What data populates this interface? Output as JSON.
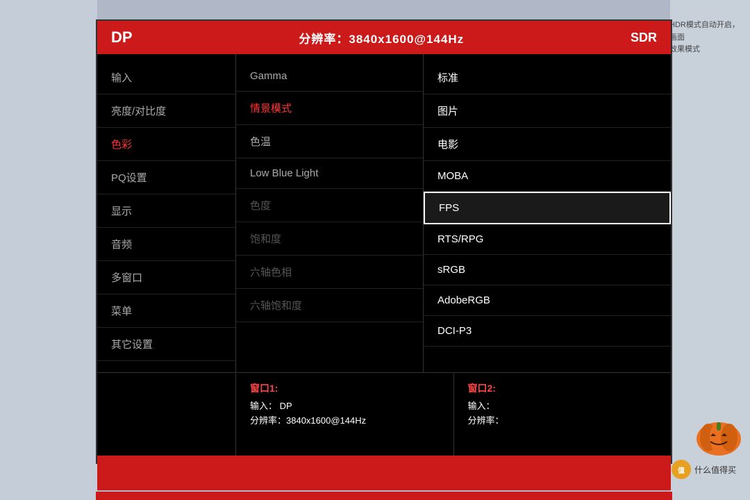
{
  "header": {
    "input_label": "DP",
    "resolution_label": "分辨率：3840x1600@144Hz",
    "mode_label": "SDR"
  },
  "nav_items": [
    {
      "label": "输入",
      "active": false
    },
    {
      "label": "亮度/对比度",
      "active": false
    },
    {
      "label": "色彩",
      "active": true
    },
    {
      "label": "PQ设置",
      "active": false
    },
    {
      "label": "显示",
      "active": false
    },
    {
      "label": "音频",
      "active": false
    },
    {
      "label": "多窗口",
      "active": false
    },
    {
      "label": "菜单",
      "active": false
    },
    {
      "label": "其它设置",
      "active": false
    }
  ],
  "middle_items": [
    {
      "label": "Gamma",
      "active": false,
      "dimmed": false
    },
    {
      "label": "情景模式",
      "active": true,
      "dimmed": false
    },
    {
      "label": "色温",
      "active": false,
      "dimmed": false
    },
    {
      "label": "Low Blue Light",
      "active": false,
      "dimmed": false
    },
    {
      "label": "色度",
      "active": false,
      "dimmed": true
    },
    {
      "label": "饱和度",
      "active": false,
      "dimmed": true
    },
    {
      "label": "六轴色相",
      "active": false,
      "dimmed": true
    },
    {
      "label": "六轴饱和度",
      "active": false,
      "dimmed": true
    }
  ],
  "right_items": [
    {
      "label": "标准",
      "selected": false,
      "dimmed": false
    },
    {
      "label": "图片",
      "selected": false,
      "dimmed": false
    },
    {
      "label": "电影",
      "selected": false,
      "dimmed": false
    },
    {
      "label": "MOBA",
      "selected": false,
      "dimmed": false
    },
    {
      "label": "FPS",
      "selected": true,
      "dimmed": false
    },
    {
      "label": "RTS/RPG",
      "selected": false,
      "dimmed": false
    },
    {
      "label": "sRGB",
      "selected": false,
      "dimmed": false
    },
    {
      "label": "AdobeRGB",
      "selected": false,
      "dimmed": false
    },
    {
      "label": "DCI-P3",
      "selected": false,
      "dimmed": false
    }
  ],
  "bottom": {
    "window1_title": "窗口1:",
    "window1_input": "输入：  DP",
    "window1_resolution": "分辨率：3840x1600@144Hz",
    "window2_title": "窗口2:",
    "window2_input": "输入：",
    "window2_resolution": "分辨率："
  },
  "right_side": {
    "top_text": "HDR模式自动开启，画面效果模式",
    "bottom_text": "什么值得买"
  }
}
